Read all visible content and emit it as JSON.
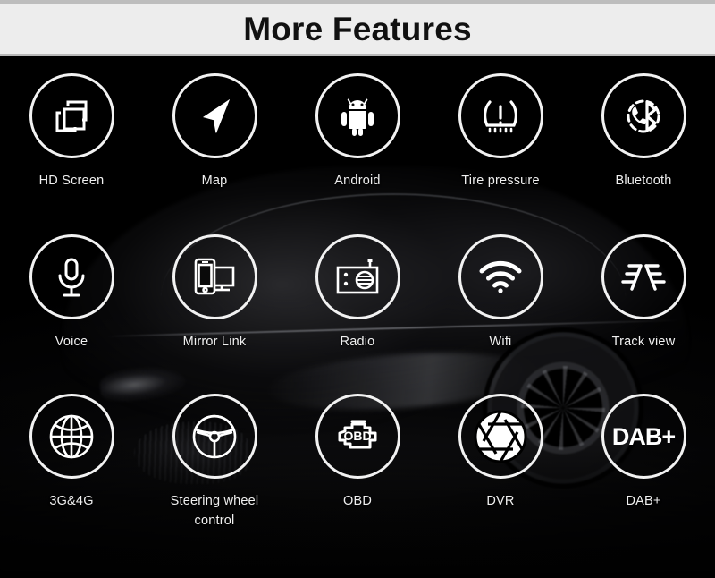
{
  "header": {
    "title": "More Features",
    "background_color": "#ededed",
    "text_color": "#111111",
    "top_border_color": "#bdbdbd"
  },
  "theme": {
    "body_background": "#000000",
    "circle_stroke": "#f2f2f2",
    "label_color": "#f0f0f0"
  },
  "background": {
    "description": "dark sports car photograph"
  },
  "features": [
    {
      "label": "HD Screen",
      "icon": "hd-screen-icon"
    },
    {
      "label": "Map",
      "icon": "navigation-arrow-icon"
    },
    {
      "label": "Android",
      "icon": "android-robot-icon"
    },
    {
      "label": "Tire pressure",
      "icon": "tire-pressure-warning-icon"
    },
    {
      "label": "Bluetooth",
      "icon": "bluetooth-phone-icon"
    },
    {
      "label": "Voice",
      "icon": "microphone-icon"
    },
    {
      "label": "Mirror Link",
      "icon": "mirror-link-icon"
    },
    {
      "label": "Radio",
      "icon": "radio-icon"
    },
    {
      "label": "Wifi",
      "icon": "wifi-icon"
    },
    {
      "label": "Track view",
      "icon": "track-view-icon"
    },
    {
      "label": "3G&4G",
      "icon": "globe-icon"
    },
    {
      "label": "Steering wheel\ncontrol",
      "icon": "steering-wheel-icon"
    },
    {
      "label": "OBD",
      "icon": "obd-engine-icon",
      "icon_text": "OBD"
    },
    {
      "label": "DVR",
      "icon": "camera-aperture-icon"
    },
    {
      "label": "DAB+",
      "icon": "dab-plus-icon",
      "icon_text": "DAB+"
    }
  ]
}
